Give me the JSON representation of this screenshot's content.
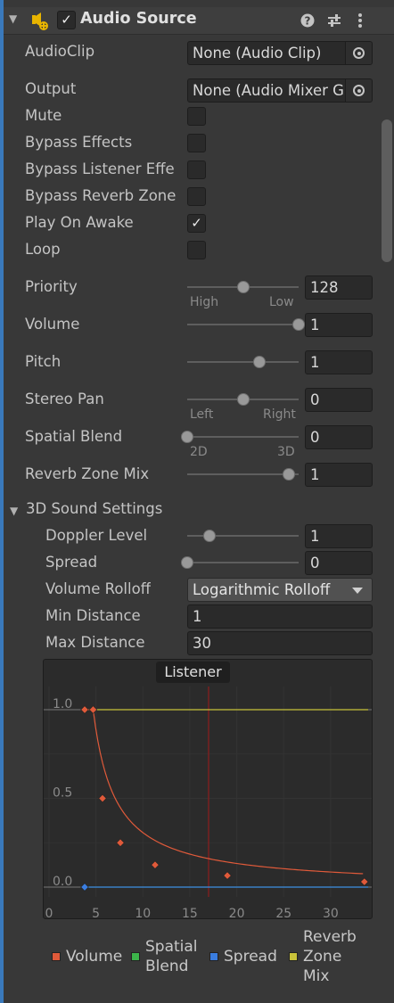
{
  "header": {
    "title": "Audio Source",
    "enabled": true,
    "help_icon": "help-icon",
    "presets_icon": "presets-sliders-icon",
    "menu_icon": "kebab-menu-icon"
  },
  "fields": {
    "audio_clip": {
      "label": "AudioClip",
      "value": "None (Audio Clip)"
    },
    "output": {
      "label": "Output",
      "value": "None (Audio Mixer G"
    },
    "mute": {
      "label": "Mute",
      "checked": false
    },
    "bypass_effects": {
      "label": "Bypass Effects",
      "checked": false
    },
    "bypass_listener": {
      "label": "Bypass Listener Effe",
      "checked": false
    },
    "bypass_reverb": {
      "label": "Bypass Reverb Zone",
      "checked": false
    },
    "play_on_awake": {
      "label": "Play On Awake",
      "checked": true,
      "check_glyph": "✓"
    },
    "loop": {
      "label": "Loop",
      "checked": false
    },
    "priority": {
      "label": "Priority",
      "value": "128",
      "level": 0.5,
      "min_label": "High",
      "max_label": "Low"
    },
    "volume": {
      "label": "Volume",
      "value": "1",
      "level": 1.0
    },
    "pitch": {
      "label": "Pitch",
      "value": "1",
      "level": 0.65
    },
    "stereo_pan": {
      "label": "Stereo Pan",
      "value": "0",
      "level": 0.5,
      "min_label": "Left",
      "max_label": "Right"
    },
    "spatial_blend": {
      "label": "Spatial Blend",
      "value": "0",
      "level": 0.0,
      "min_label": "2D",
      "max_label": "3D"
    },
    "reverb_zone_mix": {
      "label": "Reverb Zone Mix",
      "value": "1",
      "level": 0.91
    }
  },
  "sound3d": {
    "title": "3D Sound Settings",
    "doppler_level": {
      "label": "Doppler Level",
      "value": "1",
      "level": 0.2
    },
    "spread": {
      "label": "Spread",
      "value": "0",
      "level": 0.0
    },
    "volume_rolloff": {
      "label": "Volume Rolloff",
      "value": "Logarithmic Rolloff"
    },
    "min_distance": {
      "label": "Min Distance",
      "value": "1"
    },
    "max_distance": {
      "label": "Max Distance",
      "value": "30"
    }
  },
  "graph": {
    "listener_label": "Listener",
    "y_ticks": [
      "1.0",
      "0.5",
      "0.0"
    ],
    "x_ticks": [
      "0",
      "5",
      "10",
      "15",
      "20",
      "25",
      "30"
    ]
  },
  "legend": {
    "volume": "Volume",
    "spatial_blend_1": "Spatial",
    "spatial_blend_2": "Blend",
    "spread": "Spread",
    "reverb_1": "Reverb",
    "reverb_2": "Zone",
    "reverb_3": "Mix"
  },
  "colors": {
    "accent": "#3a79bb",
    "volume": "#e05a3a",
    "spatial_blend": "#3cb34a",
    "spread": "#3a7de0",
    "reverb_zone_mix": "#c8c23a",
    "listener_line": "#7a2020"
  },
  "chart_data": {
    "type": "line",
    "xlim": [
      0,
      34
    ],
    "ylim": [
      0,
      1
    ],
    "series": [
      {
        "name": "Volume",
        "x": [
          3.8,
          4.7,
          5.7,
          7.6,
          11.3,
          19.0,
          33.6
        ],
        "y": [
          1.0,
          1.0,
          0.5,
          0.25,
          0.125,
          0.065,
          0.03
        ]
      },
      {
        "name": "Spatial Blend",
        "x": [
          3.8,
          34
        ],
        "y": [
          0.0,
          0.0
        ]
      },
      {
        "name": "Spread",
        "x": [
          3.8,
          34
        ],
        "y": [
          0.0,
          0.0
        ]
      },
      {
        "name": "Reverb Zone Mix",
        "x": [
          3.8,
          34
        ],
        "y": [
          1.0,
          1.0
        ]
      }
    ],
    "listener_x": 17.0
  }
}
